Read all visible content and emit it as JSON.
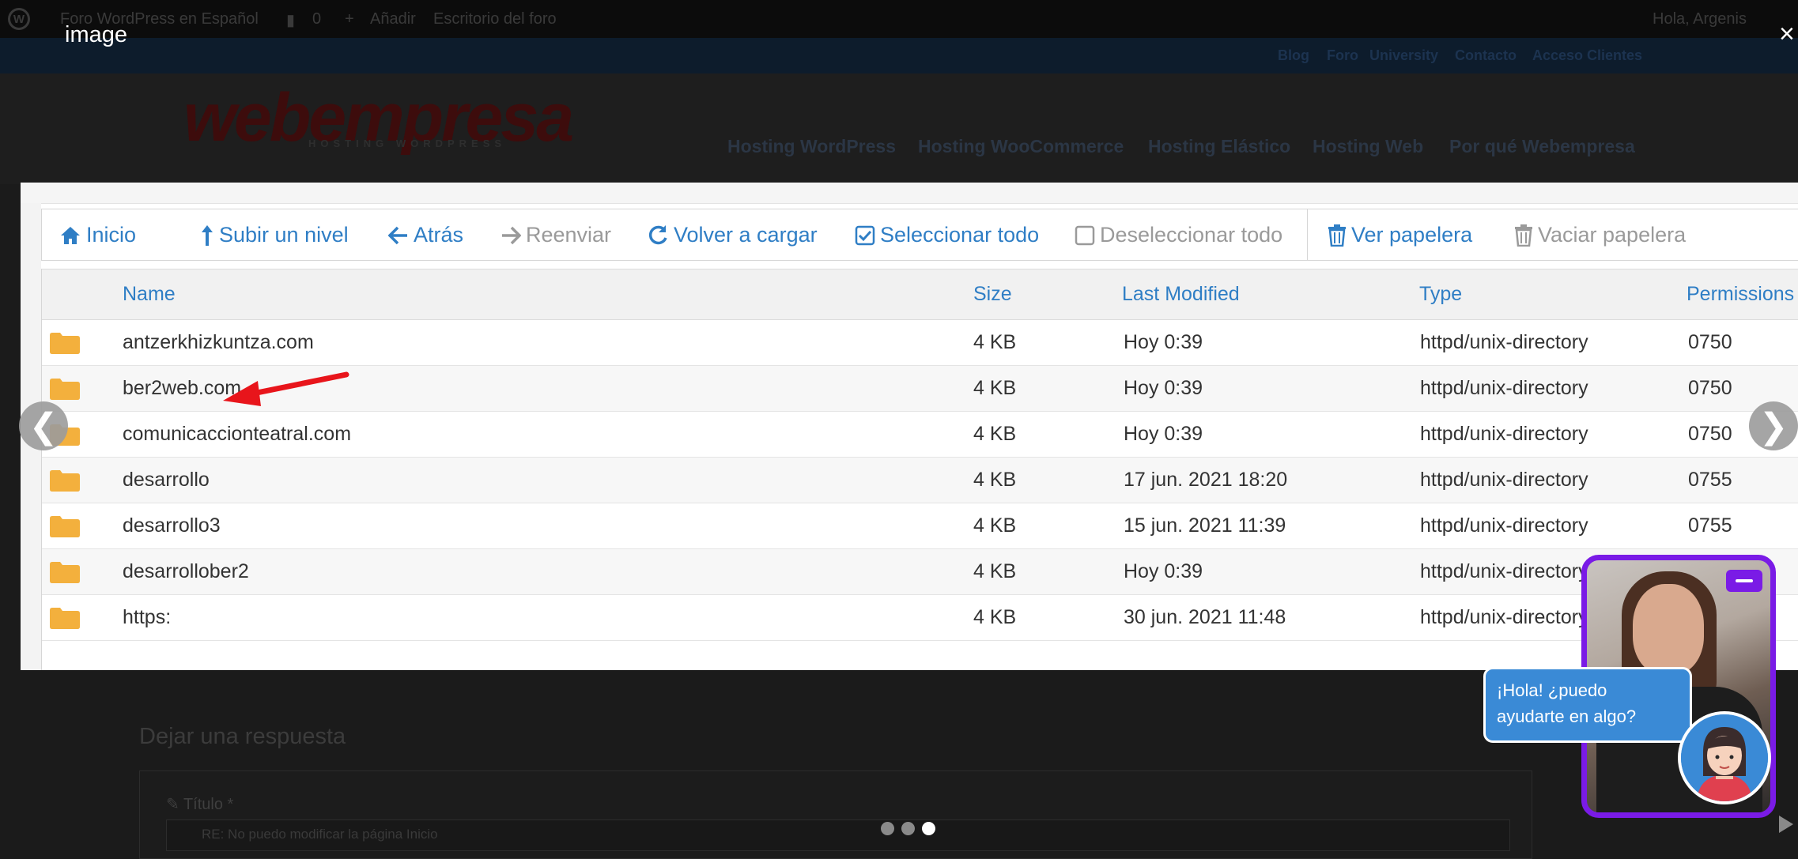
{
  "admin_bar": {
    "site_name": "Foro WordPress en Español",
    "comments_count": "0",
    "add_new": "Añadir",
    "dashboard": "Escritorio del foro",
    "greeting": "Hola, Argenis"
  },
  "top_nav": [
    "Blog",
    "Foro",
    "University",
    "Contacto",
    "Acceso Clientes"
  ],
  "site_logo": {
    "name": "webempresa",
    "tagline": "HOSTING WORDPRESS"
  },
  "main_menu": [
    "Hosting WordPress",
    "Hosting WooCommerce",
    "Hosting Elástico",
    "Hosting Web",
    "Por qué Webempresa"
  ],
  "lightbox": {
    "caption": "image",
    "close": "×",
    "prev": "❮",
    "next": "❯",
    "slides": 3,
    "active_slide": 3
  },
  "file_manager": {
    "toolbar": [
      {
        "label": "Inicio",
        "icon": "home-icon",
        "enabled": true
      },
      {
        "label": "Subir un nivel",
        "icon": "level-up-icon",
        "enabled": true
      },
      {
        "label": "Atrás",
        "icon": "arrow-left-icon",
        "enabled": true
      },
      {
        "label": "Reenviar",
        "icon": "arrow-right-icon",
        "enabled": false
      },
      {
        "label": "Volver a cargar",
        "icon": "refresh-icon",
        "enabled": true
      },
      {
        "label": "Seleccionar todo",
        "icon": "checkbox-checked-icon",
        "enabled": true
      },
      {
        "label": "Deseleccionar todo",
        "icon": "checkbox-empty-icon",
        "enabled": false
      },
      {
        "label": "Ver papelera",
        "icon": "trash-icon",
        "enabled": true
      },
      {
        "label": "Vaciar papelera",
        "icon": "trash-icon",
        "enabled": false
      }
    ],
    "columns": [
      "Name",
      "Size",
      "Last Modified",
      "Type",
      "Permissions"
    ],
    "rows": [
      {
        "name": "antzerkhizkuntza.com",
        "size": "4 KB",
        "modified": "Hoy 0:39",
        "type": "httpd/unix-directory",
        "perms": "0750"
      },
      {
        "name": "ber2web.com",
        "size": "4 KB",
        "modified": "Hoy 0:39",
        "type": "httpd/unix-directory",
        "perms": "0750"
      },
      {
        "name": "comunicaccionteatral.com",
        "size": "4 KB",
        "modified": "Hoy 0:39",
        "type": "httpd/unix-directory",
        "perms": "0750"
      },
      {
        "name": "desarrollo",
        "size": "4 KB",
        "modified": "17 jun. 2021 18:20",
        "type": "httpd/unix-directory",
        "perms": "0755"
      },
      {
        "name": "desarrollo3",
        "size": "4 KB",
        "modified": "15 jun. 2021 11:39",
        "type": "httpd/unix-directory",
        "perms": "0755"
      },
      {
        "name": "desarrollober2",
        "size": "4 KB",
        "modified": "Hoy 0:39",
        "type": "httpd/unix-directory",
        "perms": ""
      },
      {
        "name": "https:",
        "size": "4 KB",
        "modified": "30 jun. 2021 11:48",
        "type": "httpd/unix-directory",
        "perms": ""
      }
    ],
    "highlighted_row": "ber2web.com"
  },
  "reply": {
    "heading": "Dejar una respuesta",
    "title_label": "Título *",
    "title_value": "RE: No puedo modificar la página Inicio"
  },
  "chat_widget": {
    "message": "¡Hola! ¿puedo\nayudarte en algo?"
  },
  "colors": {
    "link_blue": "#2f7ec5",
    "disabled_gray": "#9a9a9a",
    "folder": "#f3b03d",
    "chat_purple": "#7a1be6",
    "chat_blue": "#3a8ad6",
    "annotation_red": "#e8151b"
  }
}
